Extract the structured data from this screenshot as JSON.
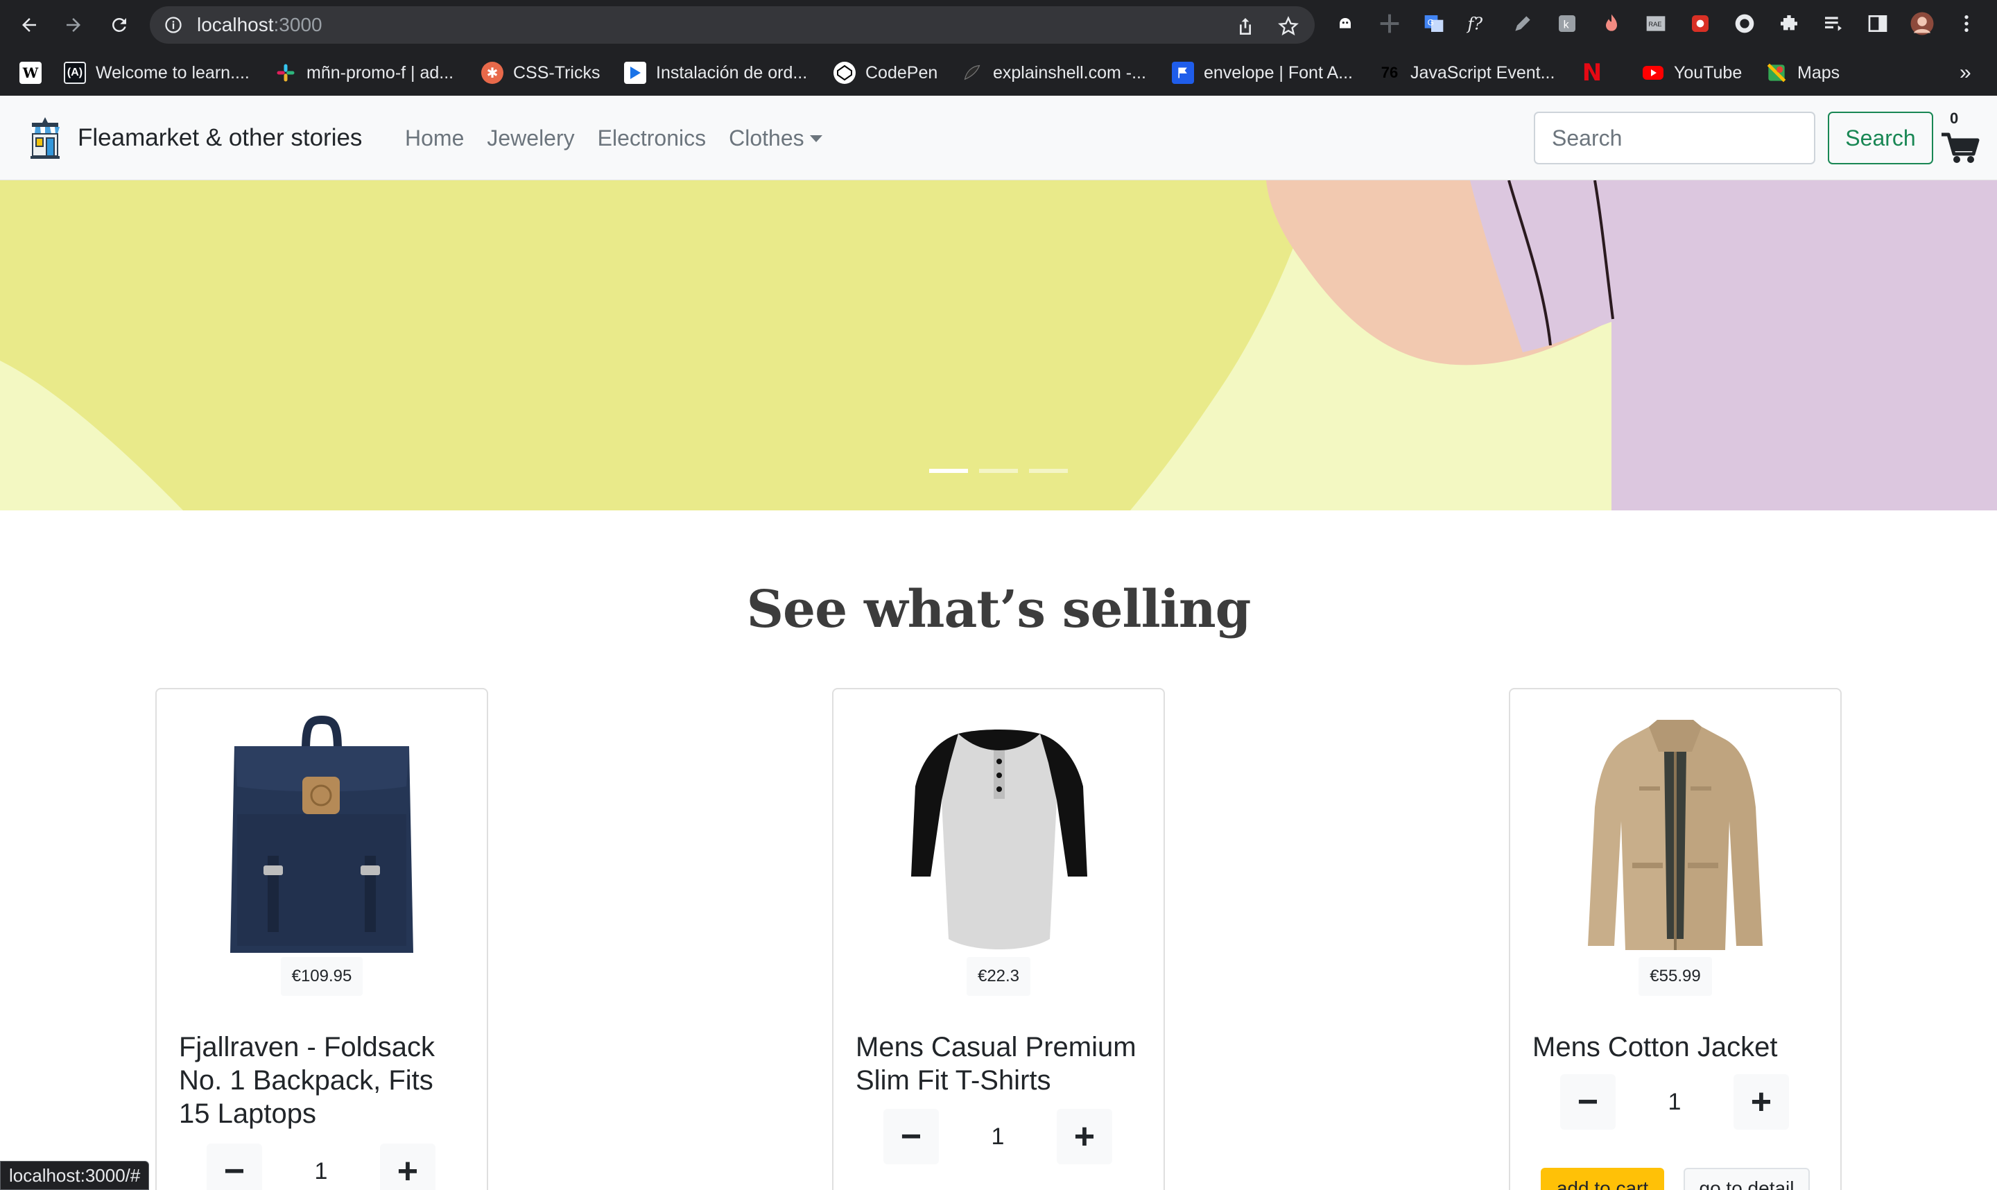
{
  "browser": {
    "url_host": "localhost",
    "url_port": ":3000",
    "bookmarks": [
      {
        "label": "",
        "icon": "wikipedia-icon"
      },
      {
        "label": "Welcome to learn....",
        "icon": "angular-icon"
      },
      {
        "label": "mñn-promo-f | ad...",
        "icon": "slack-icon"
      },
      {
        "label": "CSS-Tricks",
        "icon": "css-tricks-icon"
      },
      {
        "label": "Instalación de ord...",
        "icon": "play-icon"
      },
      {
        "label": "CodePen",
        "icon": "codepen-icon"
      },
      {
        "label": "explainshell.com -...",
        "icon": "shell-icon"
      },
      {
        "label": "envelope | Font A...",
        "icon": "flag-icon"
      },
      {
        "label": "JavaScript Event...",
        "icon": "number-icon",
        "badge": "76"
      },
      {
        "label": "",
        "icon": "netflix-icon"
      },
      {
        "label": "YouTube",
        "icon": "youtube-icon"
      },
      {
        "label": "Maps",
        "icon": "maps-icon"
      }
    ],
    "overflow": "»",
    "status_url": "localhost:3000/#"
  },
  "navbar": {
    "brand": "Fleamarket & other stories",
    "links": [
      "Home",
      "Jewelery",
      "Electronics",
      "Clothes"
    ],
    "search_placeholder": "Search",
    "search_button": "Search",
    "cart_count": "0"
  },
  "carousel": {
    "slides": 3,
    "active_slide": 1,
    "colors": {
      "yellow": "#e9ea8a",
      "pale": "#f3f8c2",
      "peach": "#f2c9b0",
      "lilac": "#dcc7df"
    }
  },
  "section": {
    "title": "See what’s selling"
  },
  "products": [
    {
      "title": "Fjallraven - Foldsack No. 1 Backpack, Fits 15 Laptops",
      "price": "€109.95",
      "qty": "1",
      "image": "backpack"
    },
    {
      "title": "Mens Casual Premium Slim Fit T-Shirts",
      "price": "€22.3",
      "qty": "1",
      "image": "tshirt"
    },
    {
      "title": "Mens Cotton Jacket",
      "price": "€55.99",
      "qty": "1",
      "image": "jacket",
      "add_label": "add to cart",
      "detail_label": "go to detail"
    }
  ],
  "qty_minus": "−",
  "qty_plus": "+"
}
